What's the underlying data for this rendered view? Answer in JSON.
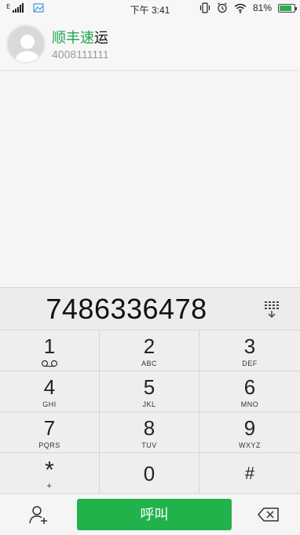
{
  "status_bar": {
    "time": "下午 3:41",
    "battery": "81%",
    "battery_level": 0.81,
    "icons": [
      "signal-icon",
      "gallery-icon",
      "vibrate-icon",
      "alarm-icon",
      "wifi-icon",
      "battery-icon"
    ]
  },
  "contact": {
    "name_highlight": "顺丰速",
    "name_rest": "运",
    "number": "4008111111"
  },
  "dialer": {
    "entered_number": "7486336478",
    "keys": [
      {
        "num": "1",
        "sub": "voicemail"
      },
      {
        "num": "2",
        "sub": "ABC"
      },
      {
        "num": "3",
        "sub": "DEF"
      },
      {
        "num": "4",
        "sub": "GHI"
      },
      {
        "num": "5",
        "sub": "JKL"
      },
      {
        "num": "6",
        "sub": "MNO"
      },
      {
        "num": "7",
        "sub": "PQRS"
      },
      {
        "num": "8",
        "sub": "TUV"
      },
      {
        "num": "9",
        "sub": "WXYZ"
      },
      {
        "num": "*",
        "sub": "+"
      },
      {
        "num": "0",
        "sub": ""
      },
      {
        "num": "#",
        "sub": ""
      }
    ],
    "call_label": "呼叫"
  },
  "colors": {
    "accent": "#22b24c",
    "highlight": "#1aa84a"
  }
}
